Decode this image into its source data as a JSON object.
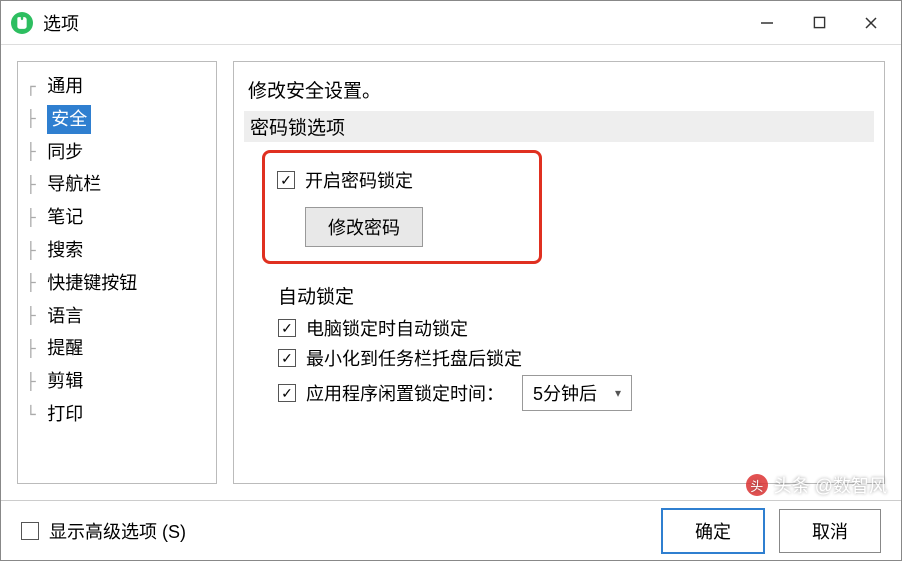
{
  "titlebar": {
    "title": "选项"
  },
  "sidebar": {
    "items": [
      {
        "label": "通用",
        "selected": false
      },
      {
        "label": "安全",
        "selected": true
      },
      {
        "label": "同步",
        "selected": false
      },
      {
        "label": "导航栏",
        "selected": false
      },
      {
        "label": "笔记",
        "selected": false
      },
      {
        "label": "搜索",
        "selected": false
      },
      {
        "label": "快捷键按钮",
        "selected": false
      },
      {
        "label": "语言",
        "selected": false
      },
      {
        "label": "提醒",
        "selected": false
      },
      {
        "label": "剪辑",
        "selected": false
      },
      {
        "label": "打印",
        "selected": false
      }
    ]
  },
  "main": {
    "description": "修改安全设置。",
    "password_section": {
      "header": "密码锁选项",
      "enable_label": "开启密码锁定",
      "enable_checked": true,
      "change_button": "修改密码"
    },
    "autolock_section": {
      "header": "自动锁定",
      "lock_on_pc_lock": {
        "label": "电脑锁定时自动锁定",
        "checked": true
      },
      "lock_on_minimize": {
        "label": "最小化到任务栏托盘后锁定",
        "checked": true
      },
      "idle_lock": {
        "label": "应用程序闲置锁定时间：",
        "checked": true,
        "selected_option": "5分钟后"
      }
    }
  },
  "footer": {
    "advanced_label": "显示高级选项 (S)",
    "advanced_checked": false,
    "ok": "确定",
    "cancel": "取消"
  },
  "watermark": "头条 @数智风"
}
